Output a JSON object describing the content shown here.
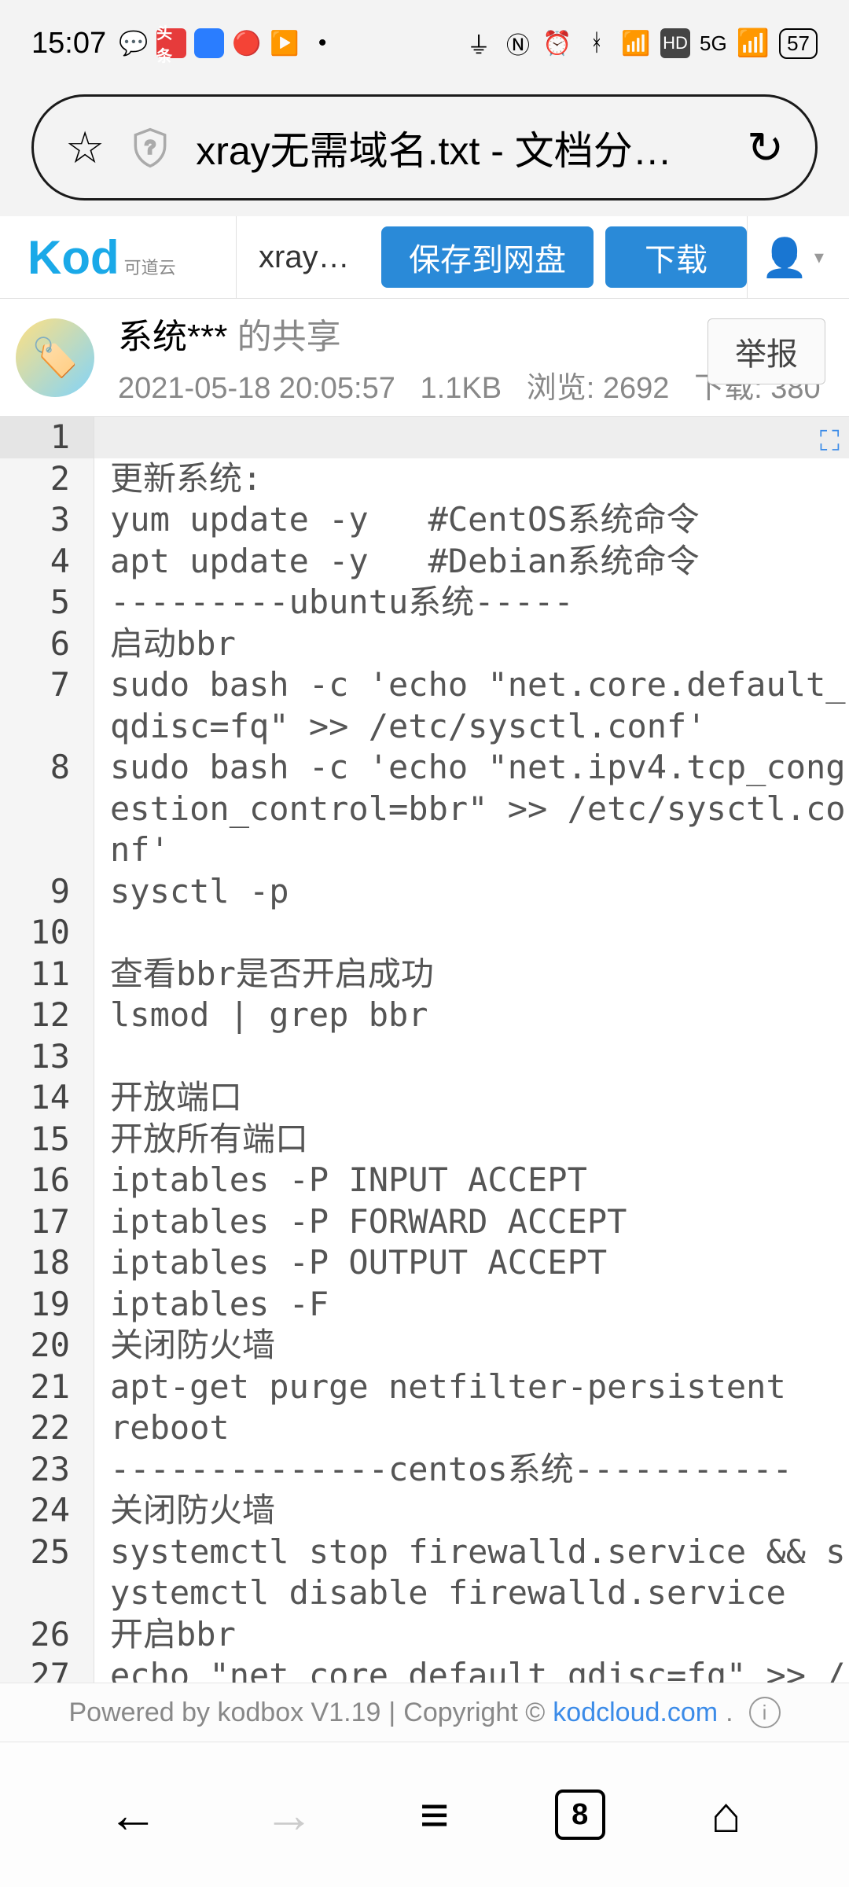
{
  "status": {
    "time": "15:07",
    "network": "5G",
    "battery": "57",
    "hd_label": "HD"
  },
  "browser": {
    "url_display": "xray无需域名.txt - 文档分…",
    "tab_count": "8"
  },
  "toolbar": {
    "logo_main": "Kod",
    "logo_sub": "可道云",
    "tab_label": "xray…",
    "save_label": "保存到网盘",
    "download_label": "下载"
  },
  "share": {
    "owner": "系统***",
    "owner_suffix": " 的共享",
    "datetime": "2021-05-18 20:05:57",
    "size": "1.1KB",
    "views_label": "浏览:",
    "views": "2692",
    "downloads_label": "下载:",
    "downloads": "380",
    "report_label": "举报"
  },
  "code": {
    "lines": [
      {
        "n": "1",
        "t": ""
      },
      {
        "n": "2",
        "t": "更新系统:"
      },
      {
        "n": "3",
        "t": "yum update -y   #CentOS系统命令"
      },
      {
        "n": "4",
        "t": "apt update -y   #Debian系统命令"
      },
      {
        "n": "5",
        "t": "---------ubuntu系统-----"
      },
      {
        "n": "6",
        "t": "启动bbr"
      },
      {
        "n": "7",
        "t": "sudo bash -c 'echo \"net.core.default_qdisc=fq\" >> /etc/sysctl.conf'"
      },
      {
        "n": "8",
        "t": "sudo bash -c 'echo \"net.ipv4.tcp_congestion_control=bbr\" >> /etc/sysctl.conf'"
      },
      {
        "n": "9",
        "t": "sysctl -p"
      },
      {
        "n": "10",
        "t": ""
      },
      {
        "n": "11",
        "t": "查看bbr是否开启成功"
      },
      {
        "n": "12",
        "t": "lsmod | grep bbr"
      },
      {
        "n": "13",
        "t": ""
      },
      {
        "n": "14",
        "t": "开放端口"
      },
      {
        "n": "15",
        "t": "开放所有端口"
      },
      {
        "n": "16",
        "t": "iptables -P INPUT ACCEPT"
      },
      {
        "n": "17",
        "t": "iptables -P FORWARD ACCEPT"
      },
      {
        "n": "18",
        "t": "iptables -P OUTPUT ACCEPT"
      },
      {
        "n": "19",
        "t": "iptables -F"
      },
      {
        "n": "20",
        "t": "关闭防火墙"
      },
      {
        "n": "21",
        "t": "apt-get purge netfilter-persistent"
      },
      {
        "n": "22",
        "t": "reboot"
      },
      {
        "n": "23",
        "t": "--------------centos系统-----------"
      },
      {
        "n": "24",
        "t": "关闭防火墙"
      },
      {
        "n": "25",
        "t": "systemctl stop firewalld.service && systemctl disable firewalld.service"
      },
      {
        "n": "26",
        "t": "开启bbr"
      },
      {
        "n": "27",
        "t": "echo \"net core default qdisc=fq\" >> /etc"
      }
    ]
  },
  "footer": {
    "powered": "Powered by kodbox V1.19",
    "sep": "|",
    "copyright": "Copyright ©",
    "link": "kodcloud.com",
    "dot": "."
  }
}
